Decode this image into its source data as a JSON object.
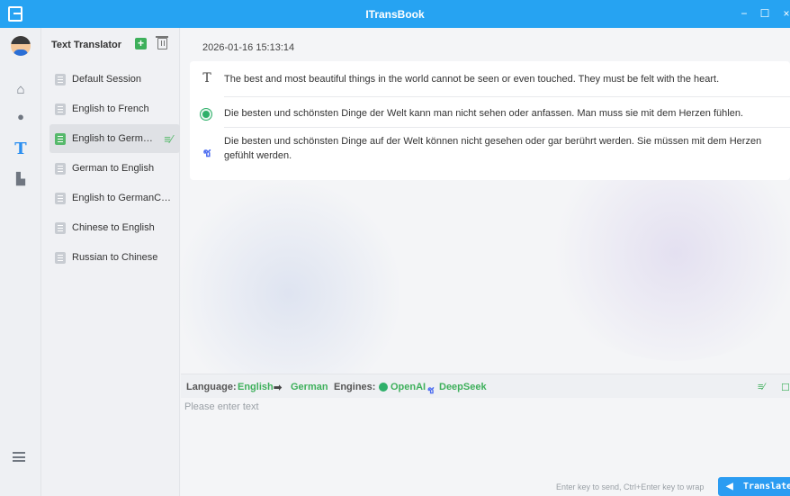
{
  "window": {
    "title": "ITransBook",
    "logo_icon": "app-logo-icon",
    "minimize_glyph": "−",
    "maximize_glyph": "☐",
    "close_glyph": "×"
  },
  "rail": {
    "items": [
      {
        "name": "avatar",
        "icon": "user-avatar"
      },
      {
        "name": "home",
        "icon": "home-icon",
        "glyph": "⌂"
      },
      {
        "name": "chat",
        "icon": "chat-icon",
        "glyph": "●"
      },
      {
        "name": "text-translate",
        "icon": "text-t-icon",
        "glyph": "T",
        "active": true
      },
      {
        "name": "document",
        "icon": "document-icon",
        "glyph": "▙"
      }
    ],
    "menu_icon": "menu-list-icon"
  },
  "sessions": {
    "title": "Text Translator",
    "add_glyph": "+",
    "items": [
      {
        "label": "Default Session"
      },
      {
        "label": "English to French"
      },
      {
        "label": "English to German",
        "active": true
      },
      {
        "label": "German to English"
      },
      {
        "label": "English to GermanChine..."
      },
      {
        "label": "Chinese to English"
      },
      {
        "label": "Russian to Chinese"
      }
    ],
    "active_mark_glyph": "≡⁄"
  },
  "main": {
    "timestamp": "2026-01-16 15:13:14",
    "source_glyph": "T",
    "source_text": "The best and most beautiful things in the world cannot be seen or even touched. They must be felt with the heart.",
    "openai_translation": "Die besten und schönsten Dinge der Welt kann man nicht sehen oder anfassen. Man muss sie mit dem Herzen fühlen.",
    "deepseek_glyph": "ช",
    "deepseek_translation": "Die besten und schönsten Dinge auf der Welt können nicht gesehen oder gar berührt werden. Sie müssen mit dem Herzen gefühlt werden."
  },
  "lang_bar": {
    "language_label": "Language:",
    "source_lang": "English",
    "arrow": "➡",
    "target_lang": "German",
    "engines_label": "Engines:",
    "engine_1": "OpenAI",
    "engine_2": "DeepSeek",
    "engine_2_glyph": "ช",
    "right_icon_1": "≡⁄",
    "right_icon_2": "☐"
  },
  "input": {
    "placeholder": "Please enter text",
    "value": "",
    "hint": "Enter key to send, Ctrl+Enter key to wrap",
    "translate_icon": "◀",
    "translate_label": "Translate"
  },
  "colors": {
    "accent": "#26a3f2",
    "green": "#3eb05b",
    "deepseek_blue": "#4c6cf0"
  }
}
